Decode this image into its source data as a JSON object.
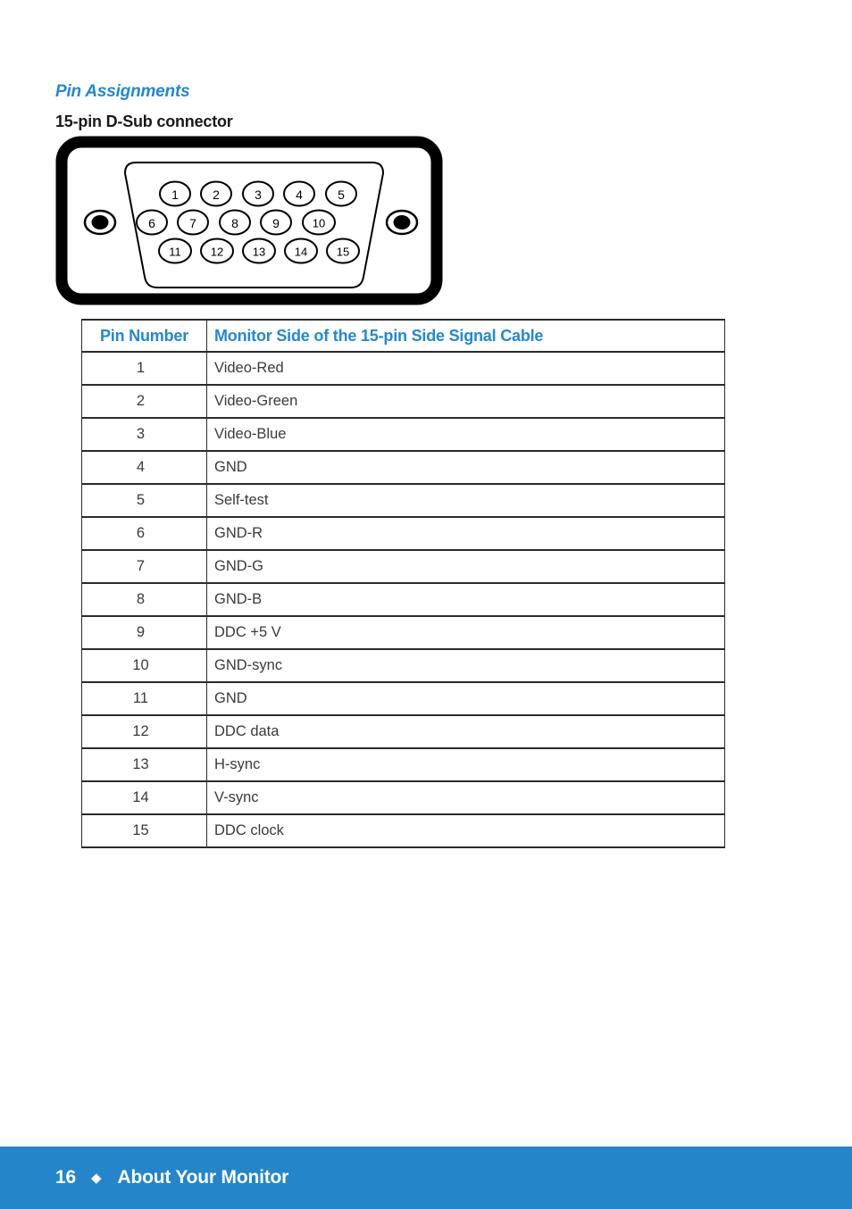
{
  "page": {
    "heading": "Pin Assignments",
    "sub_heading": "15-pin D-Sub connector",
    "accent_color": "#2288d4",
    "footer_bar_color": "#2585c9",
    "background_color": "#ffffff"
  },
  "connector_diagram": {
    "name": "15-pin D-Sub connector",
    "screw_holes": 2,
    "pin_rows": [
      [
        "1",
        "2",
        "3",
        "4",
        "5"
      ],
      [
        "6",
        "7",
        "8",
        "9",
        "10"
      ],
      [
        "11",
        "12",
        "13",
        "14",
        "15"
      ]
    ]
  },
  "table": {
    "headers": [
      "Pin Number",
      "Monitor Side of the 15-pin Side Signal Cable"
    ],
    "rows": [
      {
        "pin": "1",
        "signal": "Video-Red"
      },
      {
        "pin": "2",
        "signal": "Video-Green"
      },
      {
        "pin": "3",
        "signal": "Video-Blue"
      },
      {
        "pin": "4",
        "signal": "GND"
      },
      {
        "pin": "5",
        "signal": "Self-test"
      },
      {
        "pin": "6",
        "signal": "GND-R"
      },
      {
        "pin": "7",
        "signal": "GND-G"
      },
      {
        "pin": "8",
        "signal": "GND-B"
      },
      {
        "pin": "9",
        "signal": "DDC +5 V"
      },
      {
        "pin": "10",
        "signal": "GND-sync"
      },
      {
        "pin": "11",
        "signal": "GND"
      },
      {
        "pin": "12",
        "signal": "DDC data"
      },
      {
        "pin": "13",
        "signal": "H-sync"
      },
      {
        "pin": "14",
        "signal": "V-sync"
      },
      {
        "pin": "15",
        "signal": "DDC clock"
      }
    ]
  },
  "footer": {
    "page_number": "16",
    "separator": "◆",
    "section": "About Your Monitor"
  }
}
